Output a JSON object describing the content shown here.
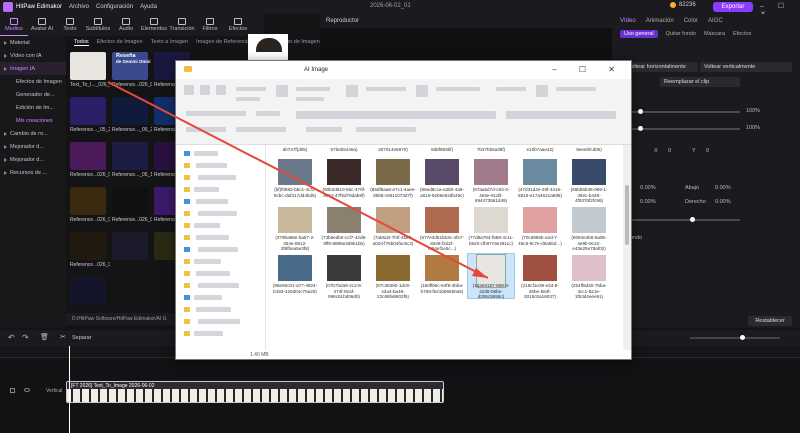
{
  "app": {
    "name": "HitPaw Edimakor",
    "menu": [
      "Archivo",
      "Configuración",
      "Ayuda"
    ],
    "project_title": "2026-06-02_01",
    "credits": "82236",
    "export_label": "Exportar"
  },
  "toolbar": [
    {
      "label": "Medios",
      "icon": "media-icon",
      "active": true
    },
    {
      "label": "Avatar AI",
      "icon": "avatar-icon"
    },
    {
      "label": "Texto",
      "icon": "text-icon"
    },
    {
      "label": "Subtítulos",
      "icon": "subtitles-icon"
    },
    {
      "label": "Audio",
      "icon": "audio-icon"
    },
    {
      "label": "Elementos",
      "icon": "elements-icon"
    },
    {
      "label": "Transición",
      "icon": "transition-icon"
    },
    {
      "label": "Filtros",
      "icon": "filters-icon"
    },
    {
      "label": "Efectos",
      "icon": "effects-icon"
    }
  ],
  "sidenav": [
    {
      "label": "Material",
      "arrow": true
    },
    {
      "label": "Vídeo con IA",
      "arrow": true
    },
    {
      "label": "Imagen IA",
      "arrow": true,
      "active": true
    },
    {
      "label": "Efectos de Imagen",
      "sub": true
    },
    {
      "label": "Generador de...",
      "sub": true
    },
    {
      "label": "Edición de Im...",
      "sub": true
    },
    {
      "label": "Mis creaciones",
      "sub": true,
      "purple": true
    },
    {
      "label": "Cambio de ro...",
      "arrow": true
    },
    {
      "label": "Mejorador d...",
      "arrow": true
    },
    {
      "label": "Mejorador d...",
      "arrow": true
    },
    {
      "label": "Recursos de ...",
      "arrow": true
    }
  ],
  "media_tabs": [
    "Todos",
    "Efectos de Imagen",
    "Texto a Imagen",
    "Imagen de Referencia",
    "Reestilización de Imagen"
  ],
  "media_items": [
    {
      "label": "Text_To_I..._026_06_02",
      "color": "#e9e6e2"
    },
    {
      "label": "Reference...026_06",
      "color": "#3a4a8c"
    },
    {
      "label": "Reference..._05_27(6)",
      "color": "#1b1840"
    },
    {
      "label": "Reference..._05_27(6)",
      "color": "#2a1f66"
    },
    {
      "label": "Reference..._05_27(6)",
      "color": "#101a3a"
    },
    {
      "label": "Reference...026_05_27",
      "color": "#0f2e6a"
    },
    {
      "label": "Reference...026_05_27",
      "color": "#4a1a5a"
    },
    {
      "label": "Reference..._05_19",
      "color": "#1c1c44"
    },
    {
      "label": "Reference...026_05_19",
      "color": "#2a1040"
    },
    {
      "label": "Reference...026_05_19",
      "color": "#3a2a10"
    },
    {
      "label": "Reference...026_05_12",
      "color": "#101010"
    },
    {
      "label": "Reference...026_05_11",
      "color": "#3a1a6a"
    },
    {
      "label": "Reference...026_05_11",
      "color": "#221a10"
    },
    {
      "label": "",
      "color": "#1a1a2a"
    },
    {
      "label": "",
      "color": "#2a2a14"
    },
    {
      "label": "",
      "color": "#14142a"
    }
  ],
  "media_banner": {
    "line1": "Reseña",
    "line2": "de Gemini Omni"
  },
  "path": "D:/HitPaw Software/HitPaw Edimakor/AI G",
  "player": {
    "header": "Reproductor"
  },
  "right_panel": {
    "tabs": [
      "Vídeo",
      "Animación",
      "Color",
      "AIGC"
    ],
    "subtabs": [
      "Uso general",
      "Quitar fondo",
      "Máscara",
      "Efectos"
    ],
    "flip_h": "Voltear horizontalmente",
    "flip_v": "Voltear verticalmente",
    "replace": "Reemplazar el clip",
    "pct1": "100%",
    "pct2": "100%",
    "scale_label": "ad",
    "pos_x": "X",
    "pos_x_val": "0",
    "pos_y": "Y",
    "pos_y_val": "0",
    "align_row1": [
      "Abajo",
      "0.00%"
    ],
    "align_row2": [
      "Derecho",
      "0.00%"
    ],
    "align_row1_prefix": "0.00%",
    "align_row2_prefix": "0.00%",
    "left_label1": "tar",
    "left_label2": "erdo",
    "left_label3": "uierdo",
    "fondo": "ondo",
    "reset": "Restablecer"
  },
  "timeline": {
    "split": "Separar",
    "track_label": "Vertical",
    "clip_label": "[FT 2026] Text_To_Image 2026-06-02"
  },
  "explorer": {
    "title": "AI Image",
    "status": "1.40 MB",
    "files": [
      {
        "name": "d0747f(d05)",
        "color": null
      },
      {
        "name": "57beb5446a)",
        "color": null
      },
      {
        "name": "307014e6670)",
        "color": null
      },
      {
        "name": "9d8f993bf)",
        "color": null
      },
      {
        "name": "7b37bb5a38f)",
        "color": null
      },
      {
        "name": "e10b7aae42)",
        "color": null
      },
      {
        "name": "9eeebfcd06)",
        "color": null
      },
      {
        "name": "(bf)f0883-b5c1-4cf1-9cbc-daf317dd4bd5)",
        "color": "#6a7a8a"
      },
      {
        "name": "(60b2d810-65c-479f-a452-47f6d76dab9f)",
        "color": "#3a2a2a"
      },
      {
        "name": "(65df6aa6-e7c1-4aee-85b6-c6611073d7f)",
        "color": "#7a6a4a"
      },
      {
        "name": "(96ed8cca-a250-4a9-a016-9206e82db49c)",
        "color": "#5a4a6a"
      },
      {
        "name": "(67aa5d7d-c63-3-4e5e-91d0-694473561d49)",
        "color": "#a07a8a"
      },
      {
        "name": "(47d31d4e-29f-4416-8815-e17a4621a695)",
        "color": "#6a8aa0"
      },
      {
        "name": "(66bb6b38-069-1-492c-b448-4f0376f2fc98)",
        "color": "#3a4a6a"
      },
      {
        "name": "(379ba99e-ba57-2-454e-8912-3f6fbea5e3f8)",
        "color": "#c8b89a"
      },
      {
        "name": "(73b6edb0-ccf7-42d8-9ff8-8886e3d9b1bb)",
        "color": "#8a8070"
      },
      {
        "name": "(7ab6d4-7f4f-4599-a02d-f75b04fac5c2)",
        "color": "#c0a080"
      },
      {
        "name": "(577e3d51b53c-4fe7-82e8-f2d2f-f464ef1e5c...)",
        "color": "#b06a50"
      },
      {
        "name": "(77d8a784-f588-4c11-b920-cfb97c9e2811c)",
        "color": "#ddd8d0"
      },
      {
        "name": "(70cd965b-a2d-7-45c6-9c7e-d6a5bd...)",
        "color": "#e0a0a0"
      },
      {
        "name": "(8094e4b6-5a9b-4e9b-9c22-e43e25e78af02)",
        "color": "#c0c8d0"
      },
      {
        "name": "(96e60c01-a77-4924-b192-420d04c75a20)",
        "color": "#4a6a8a"
      },
      {
        "name": "(07b7bda9-2c2-8-474f-92af-996c51bd06d0)",
        "color": "#3a3a3a"
      },
      {
        "name": "(97c36380-1dc8-43a4-ba46-22c89fa9803f9)",
        "color": "#8a6a30"
      },
      {
        "name": "(160ff66c-84f8-4bba-b768-f621b66650a5)",
        "color": "#b07a40"
      },
      {
        "name": "(163e9187-969-3-42d8-b8be-d295c5958c)",
        "color": "#e8e6e2"
      },
      {
        "name": "(219cf1e39-e34-8-46be-b84f-3015c0a16037)",
        "color": "#a05040"
      },
      {
        "name": "(254ff6d30-75ba-4cc1-821e-1f53d4eee91)",
        "color": "#e0c0c8"
      }
    ]
  }
}
